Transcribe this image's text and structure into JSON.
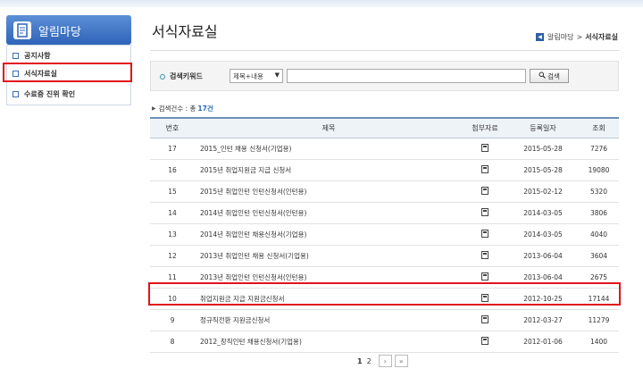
{
  "sidebar": {
    "title": "알림마당",
    "items": [
      {
        "label": "공지사항"
      },
      {
        "label": "서식자료실"
      },
      {
        "label": "수료증 진위 확인"
      }
    ]
  },
  "page": {
    "title": "서식자료실",
    "breadcrumb": [
      "알림마당",
      "서식자료실"
    ]
  },
  "search": {
    "label": "검색키워드",
    "select_value": "제목+내용",
    "input_value": "",
    "button_label": "검색"
  },
  "count": {
    "label": "검색건수 : 총",
    "value": "17건"
  },
  "table": {
    "headers": [
      "번호",
      "제목",
      "첨부자료",
      "등록일자",
      "조회"
    ],
    "rows": [
      {
        "no": "17",
        "title": "2015_인턴 채용 신청서(기업용)",
        "date": "2015-05-28",
        "views": "7276"
      },
      {
        "no": "16",
        "title": "2015년 취업지원금 지급 신청서",
        "date": "2015-05-28",
        "views": "19080"
      },
      {
        "no": "15",
        "title": "2015년 취업인턴 인턴신청서(인턴용)",
        "date": "2015-02-12",
        "views": "5320"
      },
      {
        "no": "14",
        "title": "2014년 취업인턴 인턴신청서(인턴용)",
        "date": "2014-03-05",
        "views": "3806"
      },
      {
        "no": "13",
        "title": "2014년 취업인턴 채용신청서(기업용)",
        "date": "2014-03-05",
        "views": "4040"
      },
      {
        "no": "12",
        "title": "2013년 취업인턴 채용 신청서(기업용)",
        "date": "2013-06-04",
        "views": "3604"
      },
      {
        "no": "11",
        "title": "2013년 취업인턴 인턴신청서(인턴용)",
        "date": "2013-06-04",
        "views": "2675"
      },
      {
        "no": "10",
        "title": "취업지원금 지급 지원금신청서",
        "date": "2012-10-25",
        "views": "17144"
      },
      {
        "no": "9",
        "title": "정규직전환 지원금신청서",
        "date": "2012-03-27",
        "views": "11279"
      },
      {
        "no": "8",
        "title": "2012_창직인턴 채용신청서(기업용)",
        "date": "2012-01-06",
        "views": "1400"
      }
    ]
  },
  "pagination": {
    "pages": [
      "1",
      "2"
    ],
    "current": "1",
    "next": "›",
    "last": "»"
  },
  "colors": {
    "highlight": "#e0141b",
    "sidebar_header": "#2f64b9",
    "accent": "#2c6bb7"
  }
}
